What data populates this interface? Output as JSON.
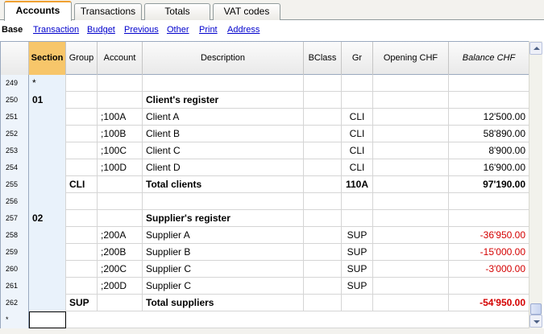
{
  "tabs": [
    {
      "label": "Accounts",
      "active": true
    },
    {
      "label": "Transactions",
      "active": false
    },
    {
      "label": "Totals",
      "active": false
    },
    {
      "label": "VAT codes",
      "active": false
    }
  ],
  "views": {
    "active": "Base",
    "links": [
      "Transaction",
      "Budget",
      "Previous",
      "Other",
      "Print",
      "Address"
    ]
  },
  "columns": {
    "section": "Section",
    "group": "Group",
    "account": "Account",
    "description": "Description",
    "bclass": "BClass",
    "gr": "Gr",
    "opening": "Opening CHF",
    "balance": "Balance CHF"
  },
  "rows": [
    {
      "num": "249",
      "section": "*",
      "group": "",
      "account": "",
      "description": "",
      "bclass": "",
      "gr": "",
      "opening": "",
      "balance": "",
      "bold": false,
      "neg": false
    },
    {
      "num": "250",
      "section": "01",
      "group": "",
      "account": "",
      "description": "Client's register",
      "bclass": "",
      "gr": "",
      "opening": "",
      "balance": "",
      "bold": true,
      "neg": false
    },
    {
      "num": "251",
      "section": "",
      "group": "",
      "account": ";100A",
      "description": "Client A",
      "bclass": "",
      "gr": "CLI",
      "opening": "",
      "balance": "12'500.00",
      "bold": false,
      "neg": false
    },
    {
      "num": "252",
      "section": "",
      "group": "",
      "account": ";100B",
      "description": "Client B",
      "bclass": "",
      "gr": "CLI",
      "opening": "",
      "balance": "58'890.00",
      "bold": false,
      "neg": false
    },
    {
      "num": "253",
      "section": "",
      "group": "",
      "account": ";100C",
      "description": "Client C",
      "bclass": "",
      "gr": "CLI",
      "opening": "",
      "balance": "8'900.00",
      "bold": false,
      "neg": false
    },
    {
      "num": "254",
      "section": "",
      "group": "",
      "account": ";100D",
      "description": "Client D",
      "bclass": "",
      "gr": "CLI",
      "opening": "",
      "balance": "16'900.00",
      "bold": false,
      "neg": false
    },
    {
      "num": "255",
      "section": "",
      "group": "CLI",
      "account": "",
      "description": "Total clients",
      "bclass": "",
      "gr": "110A",
      "opening": "",
      "balance": "97'190.00",
      "bold": true,
      "neg": false
    },
    {
      "num": "256",
      "section": "",
      "group": "",
      "account": "",
      "description": "",
      "bclass": "",
      "gr": "",
      "opening": "",
      "balance": "",
      "bold": false,
      "neg": false
    },
    {
      "num": "257",
      "section": "02",
      "group": "",
      "account": "",
      "description": "Supplier's register",
      "bclass": "",
      "gr": "",
      "opening": "",
      "balance": "",
      "bold": true,
      "neg": false
    },
    {
      "num": "258",
      "section": "",
      "group": "",
      "account": ";200A",
      "description": "Supplier A",
      "bclass": "",
      "gr": "SUP",
      "opening": "",
      "balance": "-36'950.00",
      "bold": false,
      "neg": true
    },
    {
      "num": "259",
      "section": "",
      "group": "",
      "account": ";200B",
      "description": "Supplier B",
      "bclass": "",
      "gr": "SUP",
      "opening": "",
      "balance": "-15'000.00",
      "bold": false,
      "neg": true
    },
    {
      "num": "260",
      "section": "",
      "group": "",
      "account": ";200C",
      "description": "Supplier C",
      "bclass": "",
      "gr": "SUP",
      "opening": "",
      "balance": "-3'000.00",
      "bold": false,
      "neg": true
    },
    {
      "num": "261",
      "section": "",
      "group": "",
      "account": ";200D",
      "description": "Supplier C",
      "bclass": "",
      "gr": "SUP",
      "opening": "",
      "balance": "",
      "bold": false,
      "neg": false
    },
    {
      "num": "262",
      "section": "",
      "group": "SUP",
      "account": "",
      "description": "Total suppliers",
      "bclass": "",
      "gr": "",
      "opening": "",
      "balance": "-54'950.00",
      "bold": true,
      "neg": true
    }
  ],
  "new_row_marker": "*",
  "colors": {
    "selected_header": "#f7c66a",
    "tab_highlight": "#f0a030",
    "negative": "#d40000",
    "link": "#0000cc"
  },
  "icons": [
    "scroll-up-arrow-icon",
    "scroll-down-arrow-icon"
  ]
}
